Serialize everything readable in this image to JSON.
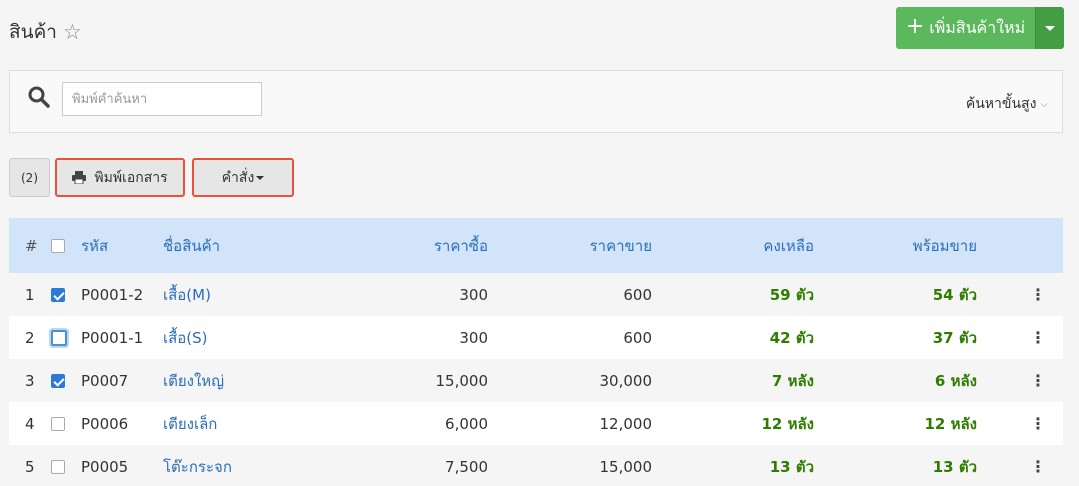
{
  "header": {
    "title": "สินค้า",
    "favorite_icon": "star-outline-icon"
  },
  "add_button": {
    "label": "เพิ่มสินค้าใหม่",
    "color": "#5cb85c",
    "dropdown_icon": "caret-down-icon"
  },
  "search": {
    "placeholder": "พิมพ์คำค้นหา",
    "value": "",
    "advanced_label": "ค้นหาขั้นสูง",
    "advanced_icon": "chevron-down-icon"
  },
  "toolbar": {
    "selected_count": "(2)",
    "print_label": "พิมพ์เอกสาร",
    "print_icon": "printer-icon",
    "command_label": "คำสั่ง"
  },
  "table": {
    "headers": {
      "index": "#",
      "code": "รหัส",
      "name": "ชื่อสินค้า",
      "buy_price": "ราคาซื้อ",
      "sell_price": "ราคาขาย",
      "stock": "คงเหลือ",
      "ready": "พร้อมขาย"
    },
    "rows": [
      {
        "index": "1",
        "checked": true,
        "focused": false,
        "code": "P0001-2",
        "name": "เสื้อ(M)",
        "buy_price": "300",
        "sell_price": "600",
        "stock": "59 ตัว",
        "ready": "54 ตัว"
      },
      {
        "index": "2",
        "checked": false,
        "focused": true,
        "code": "P0001-1",
        "name": "เสื้อ(S)",
        "buy_price": "300",
        "sell_price": "600",
        "stock": "42 ตัว",
        "ready": "37 ตัว"
      },
      {
        "index": "3",
        "checked": true,
        "focused": false,
        "code": "P0007",
        "name": "เตียงใหญ่",
        "buy_price": "15,000",
        "sell_price": "30,000",
        "stock": "7 หลัง",
        "ready": "6 หลัง"
      },
      {
        "index": "4",
        "checked": false,
        "focused": false,
        "code": "P0006",
        "name": "เตียงเล็ก",
        "buy_price": "6,000",
        "sell_price": "12,000",
        "stock": "12 หลัง",
        "ready": "12 หลัง"
      },
      {
        "index": "5",
        "checked": false,
        "focused": false,
        "code": "P0005",
        "name": "โต๊ะกระจก",
        "buy_price": "7,500",
        "sell_price": "15,000",
        "stock": "13 ตัว",
        "ready": "13 ตัว"
      }
    ]
  },
  "colors": {
    "link": "#2a6ebb",
    "stock": "#2e7d00",
    "header_bg": "#d1e4f9",
    "highlight_border": "#e8523b"
  }
}
